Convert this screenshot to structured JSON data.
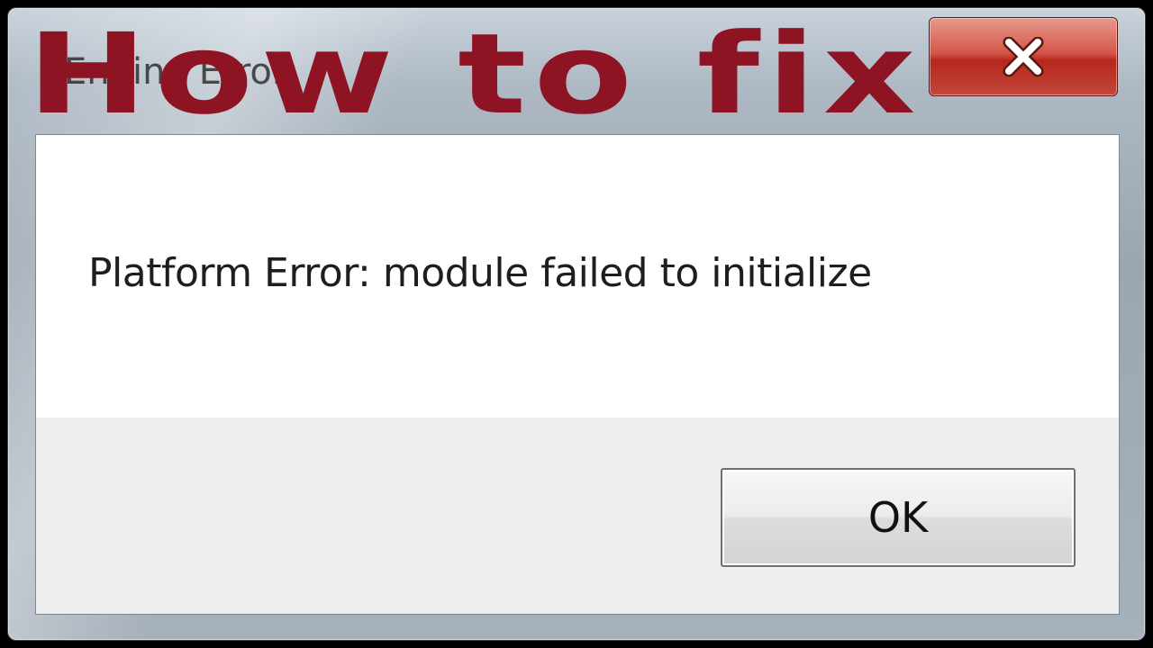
{
  "window": {
    "title": "Engine Error"
  },
  "overlay": {
    "heading": "How to fix",
    "color": "#8e1424"
  },
  "dialog": {
    "message": "Platform Error: module failed to initialize",
    "ok_label": "OK"
  },
  "icons": {
    "close": "close-icon"
  }
}
